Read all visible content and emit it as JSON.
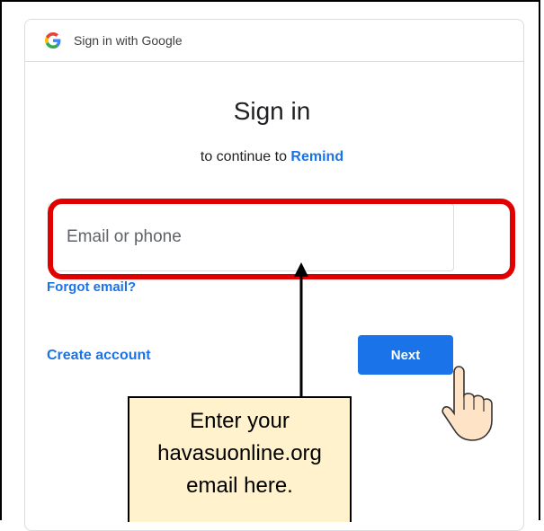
{
  "header": {
    "title": "Sign in with Google"
  },
  "signin": {
    "title": "Sign in",
    "subtitle_prefix": "to continue to",
    "app_name": "Remind",
    "email_placeholder": "Email or phone",
    "forgot_link": "Forgot email?",
    "create_link": "Create account",
    "next_label": "Next"
  },
  "callout": {
    "lines": [
      "Enter your",
      "havasuonline.org",
      "email here."
    ]
  },
  "colors": {
    "accent": "#1a73e8",
    "highlight": "#e00000",
    "callout_bg": "#fff2cc"
  },
  "icons": {
    "brand": "google-g-icon",
    "pointer": "pointing-hand-icon"
  }
}
